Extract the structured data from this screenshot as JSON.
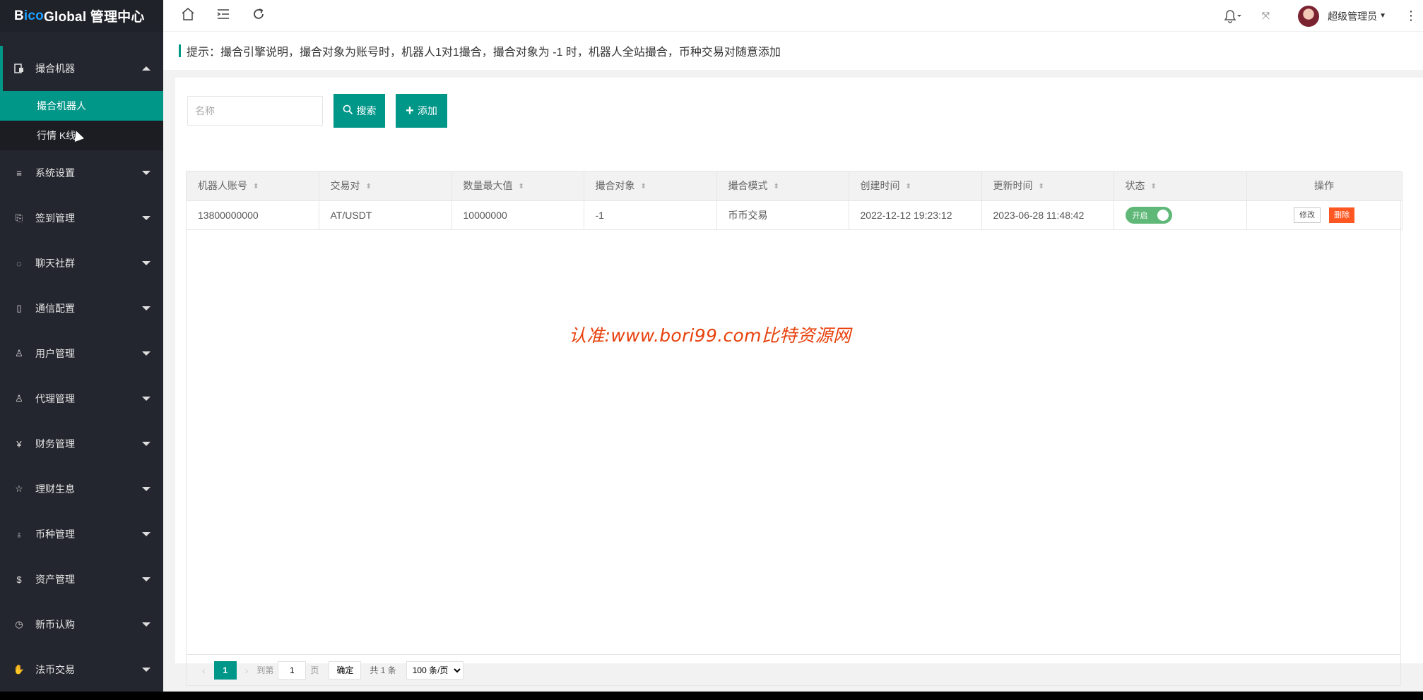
{
  "brand": {
    "prefix": "B",
    "accent": "ico",
    "suffix": " Global 管理中心"
  },
  "sidebar": {
    "open_group": {
      "label": "撮合机器",
      "icon": "robot-icon"
    },
    "subitems": [
      {
        "label": "撮合机器人",
        "active": true
      },
      {
        "label": "行情 K线",
        "active": false
      }
    ],
    "groups": [
      {
        "label": "系统设置",
        "icon": "sliders-icon"
      },
      {
        "label": "签到管理",
        "icon": "sign-in-icon"
      },
      {
        "label": "聊天社群",
        "icon": "chat-icon"
      },
      {
        "label": "通信配置",
        "icon": "phone-icon"
      },
      {
        "label": "用户管理",
        "icon": "users-icon"
      },
      {
        "label": "代理管理",
        "icon": "user-icon"
      },
      {
        "label": "财务管理",
        "icon": "yen-icon"
      },
      {
        "label": "理财生息",
        "icon": "star-icon"
      },
      {
        "label": "币种管理",
        "icon": "coin-icon"
      },
      {
        "label": "资产管理",
        "icon": "dollar-icon"
      },
      {
        "label": "新币认购",
        "icon": "clock-icon"
      },
      {
        "label": "法币交易",
        "icon": "hand-icon"
      }
    ]
  },
  "header": {
    "icons": [
      "home-icon",
      "menu-fold-icon",
      "refresh-icon"
    ],
    "user_name": "超级管理员"
  },
  "tip": {
    "text": "提示：撮合引擎说明，撮合对象为账号时，机器人1对1撮合，撮合对象为 -1 时，机器人全站撮合，币种交易对随意添加"
  },
  "search": {
    "placeholder": "名称",
    "search_label": "搜索",
    "add_label": "添加"
  },
  "table": {
    "columns": [
      "机器人账号",
      "交易对",
      "数量最大值",
      "撮合对象",
      "撮合模式",
      "创建时间",
      "更新时间",
      "状态",
      "操作"
    ],
    "rows": [
      {
        "account": "13800000000",
        "pair": "AT/USDT",
        "max_qty": "10000000",
        "target": "-1",
        "mode": "币币交易",
        "created": "2022-12-12 19:23:12",
        "updated": "2023-06-28 11:48:42",
        "status": "开启",
        "edit": "修改",
        "delete": "删除"
      }
    ]
  },
  "pager": {
    "current": "1",
    "goto_prefix": "到第",
    "goto_value": "1",
    "goto_suffix": "页",
    "confirm": "确定",
    "total": "共 1 条",
    "page_size": "100 条/页"
  },
  "watermark": "认准:www.bori99.com比特资源网",
  "colors": {
    "primary": "#009688",
    "danger": "#ff5722",
    "switch_on": "#5fb878",
    "sidebar_bg": "#23262e"
  }
}
